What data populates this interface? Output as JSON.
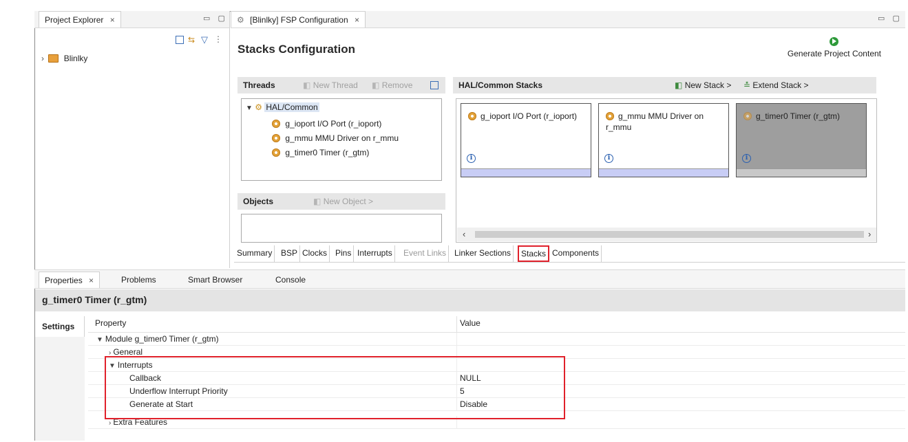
{
  "project_explorer": {
    "tab_label": "Project Explorer",
    "close_glyph": "×",
    "tree_item": "Blinlky"
  },
  "editor": {
    "tab_label": "[Blinlky] FSP Configuration",
    "close_glyph": "×",
    "page_title": "Stacks Configuration",
    "generate_label": "Generate Project Content"
  },
  "threads": {
    "header": "Threads",
    "new_thread": "New Thread",
    "remove": "Remove",
    "root": "HAL/Common",
    "items": [
      "g_ioport I/O Port (r_ioport)",
      "g_mmu MMU Driver on r_mmu",
      "g_timer0 Timer (r_gtm)"
    ]
  },
  "objects": {
    "header": "Objects",
    "new_object": "New Object >"
  },
  "stacks": {
    "header": "HAL/Common Stacks",
    "new_stack": "New Stack >",
    "extend_stack": "Extend Stack >",
    "cards": [
      {
        "title": "g_ioport I/O Port (r_ioport)"
      },
      {
        "title": "g_mmu MMU Driver on r_mmu"
      },
      {
        "title": "g_timer0 Timer (r_gtm)"
      }
    ],
    "info_glyph": "i"
  },
  "config_tabs": [
    "Summary",
    "BSP",
    "Clocks",
    "Pins",
    "Interrupts",
    "Event Links",
    "Linker Sections",
    "Stacks",
    "Components"
  ],
  "bottom_tabs": {
    "properties": "Properties",
    "problems": "Problems",
    "smart_browser": "Smart Browser",
    "console": "Console"
  },
  "properties": {
    "title": "g_timer0 Timer (r_gtm)",
    "side_tab": "Settings",
    "col_property": "Property",
    "col_value": "Value",
    "rows": [
      {
        "label": "Module g_timer0 Timer (r_gtm)",
        "value": "",
        "chev": "v"
      },
      {
        "label": "General",
        "value": "",
        "chev": ">"
      },
      {
        "label": "Interrupts",
        "value": "",
        "chev": "v"
      },
      {
        "label": "Callback",
        "value": "NULL",
        "chev": ""
      },
      {
        "label": "Underflow Interrupt Priority",
        "value": "5",
        "chev": ""
      },
      {
        "label": "Generate at Start",
        "value": "Disable",
        "chev": ""
      },
      {
        "label": "Extra Features",
        "value": "",
        "chev": ">"
      }
    ]
  },
  "colors": {
    "highlight_red": "#e0202a",
    "card_bar": "#c8cdf5",
    "selected_card": "#9e9e9e"
  }
}
